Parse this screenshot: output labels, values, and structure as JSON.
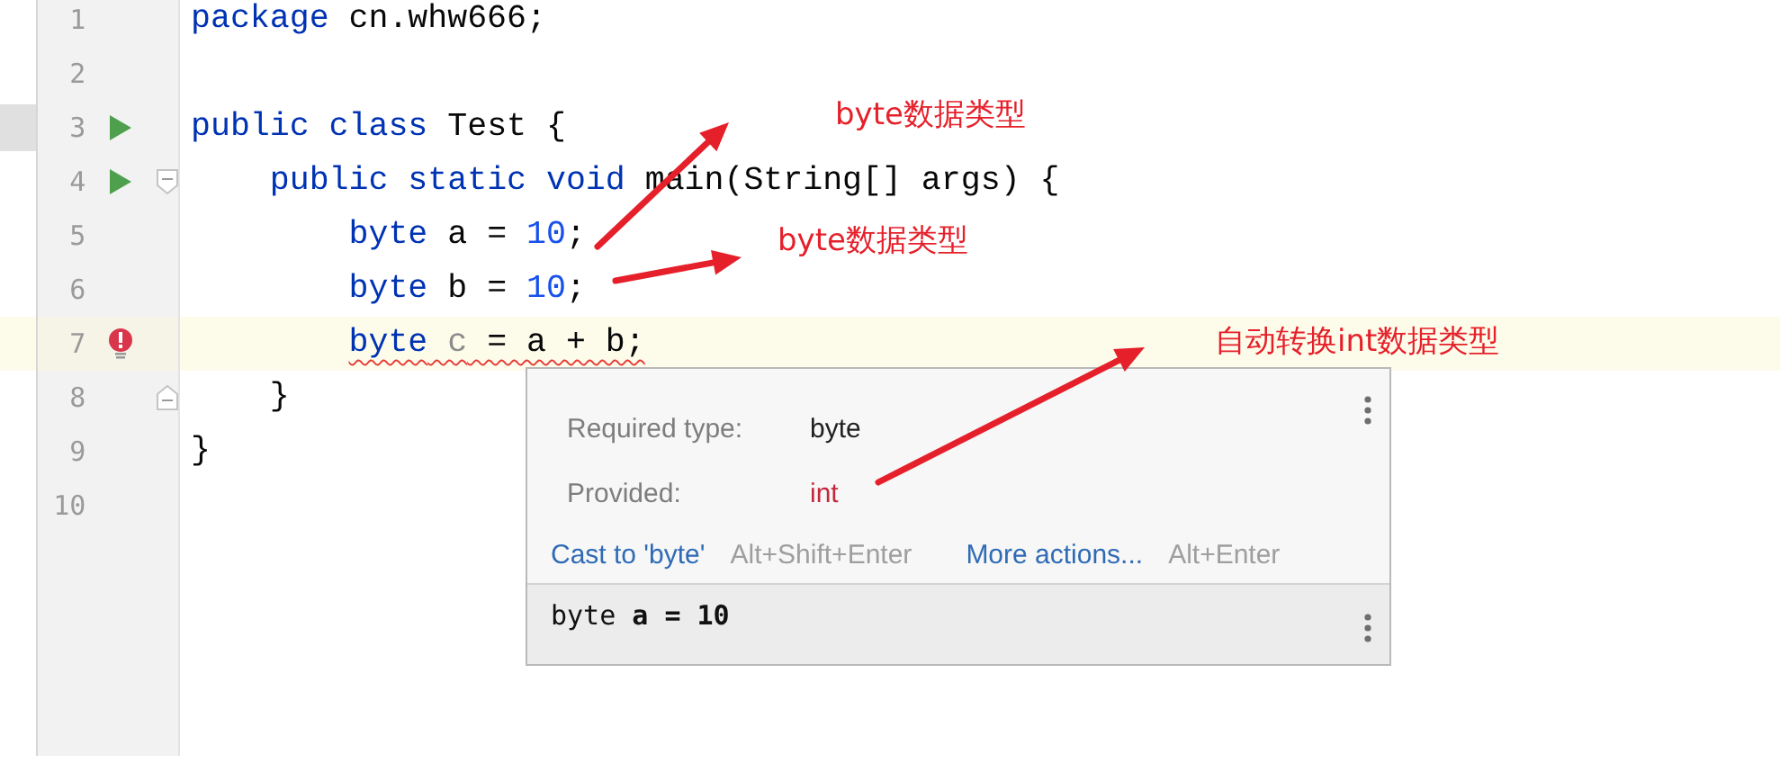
{
  "editor": {
    "lines": [
      {
        "number": "1",
        "tokens": [
          {
            "kind": "keyword",
            "text": "package"
          },
          {
            "kind": "plain",
            "text": " cn.whw666;"
          }
        ]
      },
      {
        "number": "2"
      },
      {
        "number": "3",
        "runnable": true,
        "tokens": [
          {
            "kind": "keyword",
            "text": "public class"
          },
          {
            "kind": "plain",
            "text": " Test {"
          }
        ]
      },
      {
        "number": "4",
        "runnable": true,
        "fold_start": true,
        "tokens": [
          {
            "kind": "keyword",
            "text": "    public static void"
          },
          {
            "kind": "plain",
            "text": " main(String[] args) {"
          }
        ]
      },
      {
        "number": "5",
        "tokens": [
          {
            "kind": "keyword",
            "text": "        byte"
          },
          {
            "kind": "plain",
            "text": " a = "
          },
          {
            "kind": "number",
            "text": "10"
          },
          {
            "kind": "plain",
            "text": ";"
          }
        ]
      },
      {
        "number": "6",
        "tokens": [
          {
            "kind": "keyword",
            "text": "        byte"
          },
          {
            "kind": "plain",
            "text": " b = "
          },
          {
            "kind": "number",
            "text": "10"
          },
          {
            "kind": "plain",
            "text": ";"
          }
        ]
      },
      {
        "number": "7",
        "has_error": true,
        "current": true,
        "tokens": [
          {
            "kind": "keyword",
            "text": "        byte"
          },
          {
            "kind": "unused",
            "text": " c"
          },
          {
            "kind": "plain",
            "text": " = a + b;"
          }
        ]
      },
      {
        "number": "8",
        "fold_end": true,
        "tokens": [
          {
            "kind": "plain",
            "text": "    }"
          }
        ]
      },
      {
        "number": "9",
        "tokens": [
          {
            "kind": "plain",
            "text": "}"
          }
        ]
      },
      {
        "number": "10"
      }
    ]
  },
  "popup": {
    "rows": [
      {
        "label": "Required type:",
        "value": "byte",
        "kind": "expected"
      },
      {
        "label": "Provided:",
        "value": "int",
        "kind": "mismatch"
      }
    ],
    "actions": [
      {
        "label": "Cast to 'byte'",
        "shortcut": "Alt+Shift+Enter"
      },
      {
        "label": "More actions...",
        "shortcut": "Alt+Enter"
      }
    ],
    "preview": "byte **a = 10**"
  },
  "annotations": [
    {
      "text": "byte数据类型"
    },
    {
      "text": "byte数据类型"
    },
    {
      "text": "自动转换int数据类型"
    }
  ]
}
